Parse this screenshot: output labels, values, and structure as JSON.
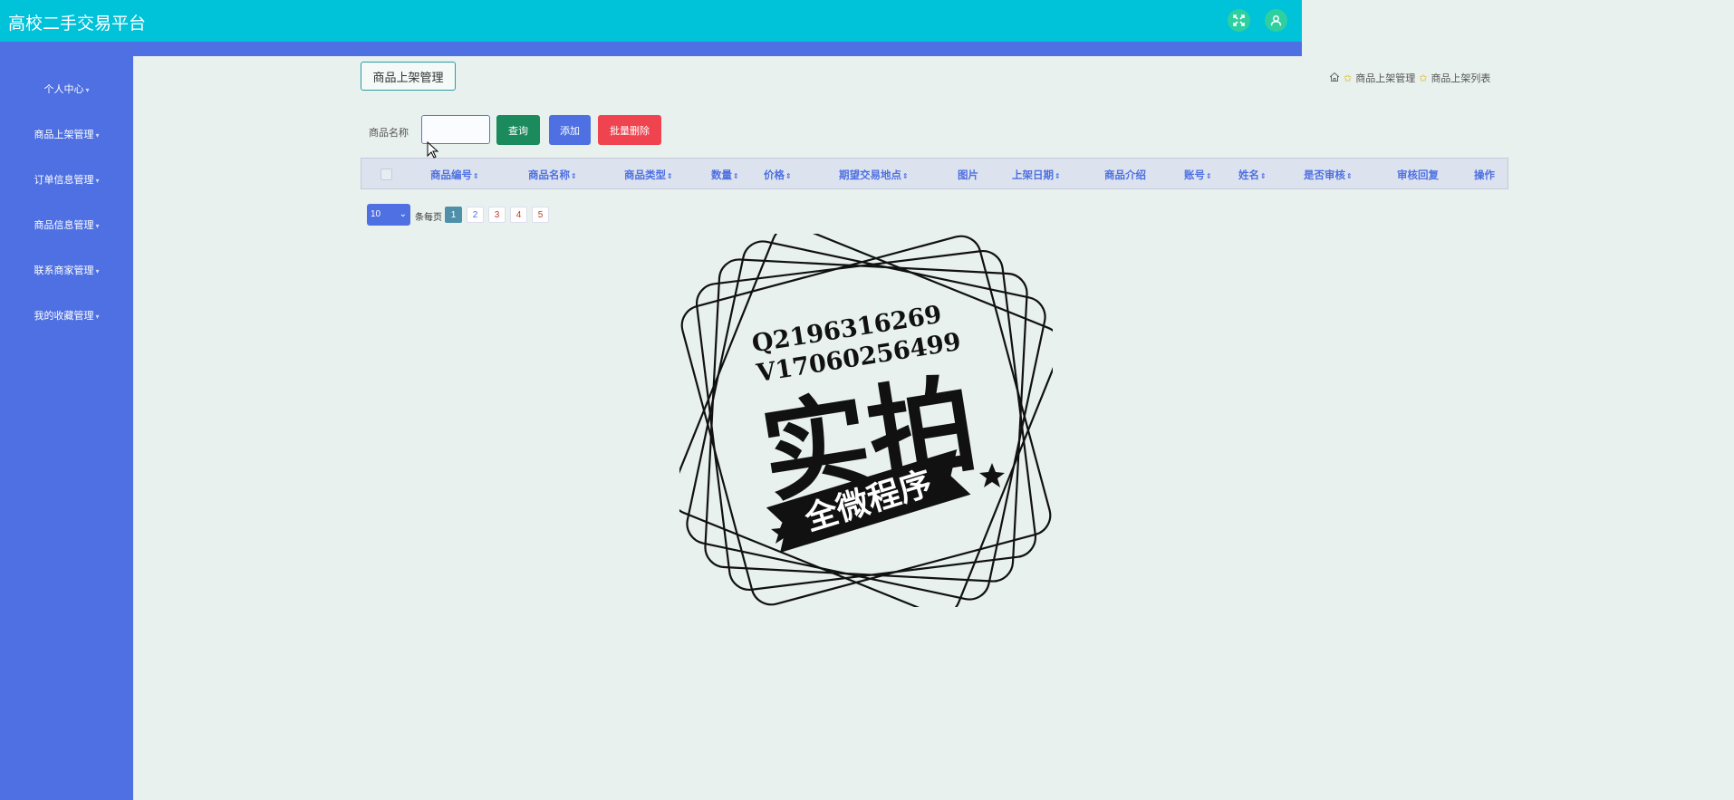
{
  "app": {
    "title": "高校二手交易平台"
  },
  "topbar": {
    "fullscreen_icon": "fullscreen-icon",
    "user_icon": "user-icon"
  },
  "sidebar": {
    "items": [
      {
        "label": "个人中心"
      },
      {
        "label": "商品上架管理"
      },
      {
        "label": "订单信息管理"
      },
      {
        "label": "商品信息管理"
      },
      {
        "label": "联系商家管理"
      },
      {
        "label": "我的收藏管理"
      }
    ]
  },
  "page": {
    "title": "商品上架管理"
  },
  "breadcrumb": {
    "items": [
      "商品上架管理",
      "商品上架列表"
    ]
  },
  "search": {
    "label": "商品名称",
    "value": ""
  },
  "buttons": {
    "query": "查询",
    "add": "添加",
    "batch_delete": "批量删除"
  },
  "table": {
    "columns": [
      {
        "label": "商品编号",
        "sortable": true
      },
      {
        "label": "商品名称",
        "sortable": true
      },
      {
        "label": "商品类型",
        "sortable": true
      },
      {
        "label": "数量",
        "sortable": true
      },
      {
        "label": "价格",
        "sortable": true
      },
      {
        "label": "期望交易地点",
        "sortable": true
      },
      {
        "label": "图片",
        "sortable": false
      },
      {
        "label": "上架日期",
        "sortable": true
      },
      {
        "label": "商品介绍",
        "sortable": false
      },
      {
        "label": "账号",
        "sortable": true
      },
      {
        "label": "姓名",
        "sortable": true
      },
      {
        "label": "是否审核",
        "sortable": true
      },
      {
        "label": "审核回复",
        "sortable": false
      },
      {
        "label": "操作",
        "sortable": false
      }
    ],
    "rows": []
  },
  "pagination": {
    "page_size": "10",
    "per_page_label": "条每页",
    "pages": [
      "1",
      "2",
      "3",
      "4",
      "5"
    ],
    "current": "1"
  },
  "watermark": {
    "line1": "Q2196316269",
    "line2": "V17060256499",
    "main": "实拍",
    "banner": "全微程序"
  },
  "colors": {
    "topbar": "#00c2d9",
    "sidebar": "#4e70e2",
    "background": "#e8f1ee",
    "query_button": "#1b8a5d",
    "delete_button": "#ef4450"
  }
}
